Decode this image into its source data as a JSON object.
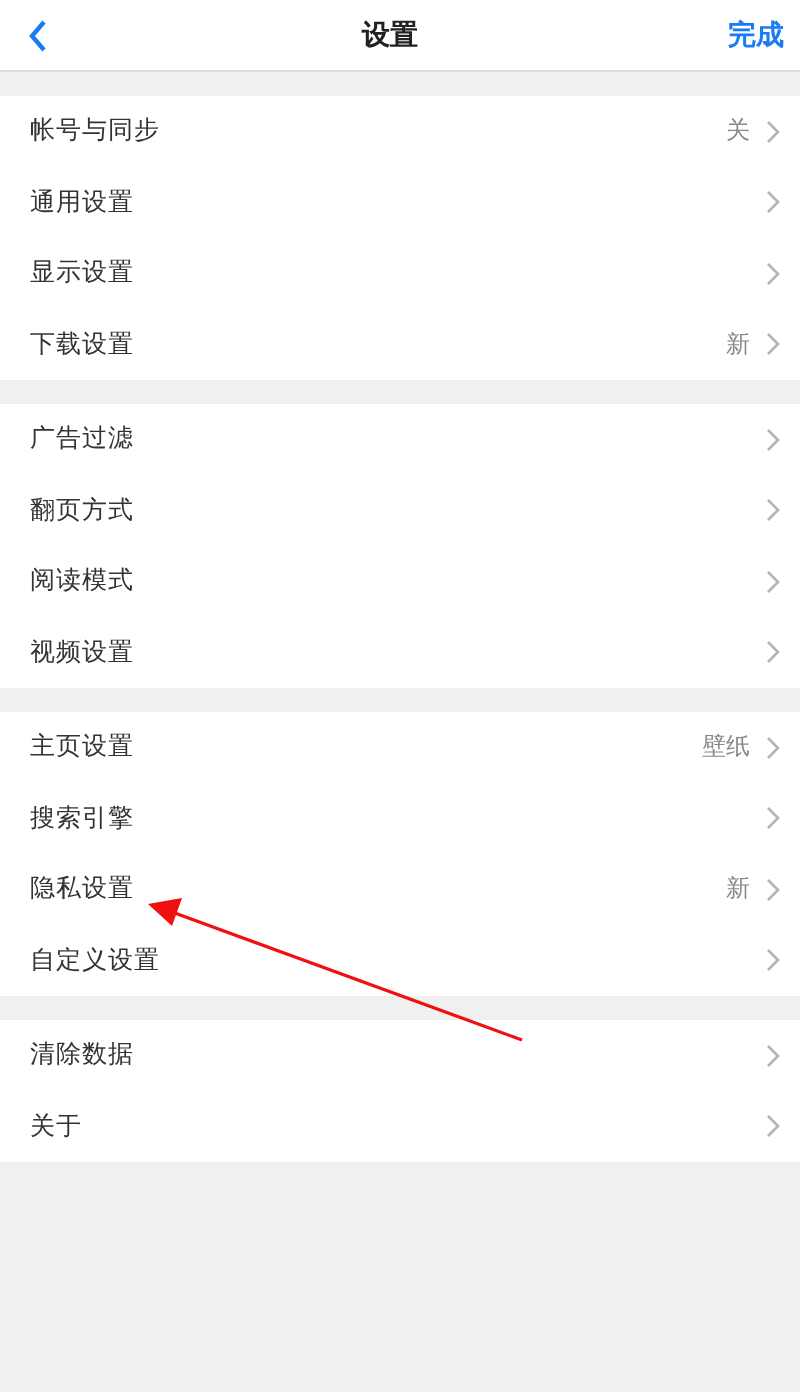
{
  "header": {
    "title": "设置",
    "done": "完成"
  },
  "groups": [
    {
      "items": [
        {
          "label": "帐号与同步",
          "value": "关"
        },
        {
          "label": "通用设置"
        },
        {
          "label": "显示设置"
        },
        {
          "label": "下载设置",
          "value": "新"
        }
      ]
    },
    {
      "items": [
        {
          "label": "广告过滤"
        },
        {
          "label": "翻页方式"
        },
        {
          "label": "阅读模式"
        },
        {
          "label": "视频设置"
        }
      ]
    },
    {
      "items": [
        {
          "label": "主页设置",
          "value": "壁纸"
        },
        {
          "label": "搜索引擎"
        },
        {
          "label": "隐私设置",
          "value": "新"
        },
        {
          "label": "自定义设置"
        }
      ]
    },
    {
      "items": [
        {
          "label": "清除数据"
        },
        {
          "label": "关于"
        }
      ]
    }
  ]
}
